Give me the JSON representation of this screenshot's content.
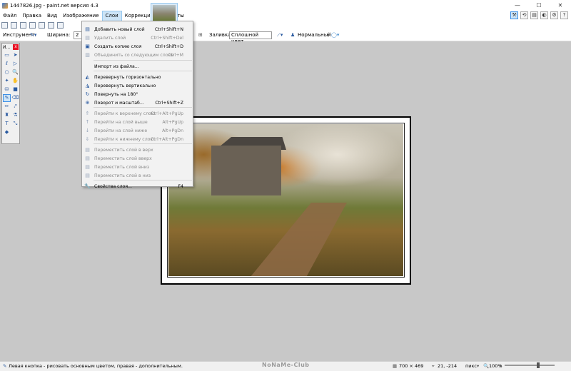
{
  "window": {
    "title": "1447826.jpg - paint.net версия 4.3",
    "minimize": "—",
    "maximize": "☐",
    "close": "✕"
  },
  "menubar": {
    "items": [
      "Файл",
      "Правка",
      "Вид",
      "Изображение",
      "Слои",
      "Коррекция",
      "Эффекты"
    ],
    "active": "Слои"
  },
  "toolbar": {
    "instrument_label": "Инструмент:",
    "width_label": "Ширина:",
    "width_value": "2",
    "fill_label": "Заливка:",
    "fill_value": "Сплошной цвет",
    "blend_value": "Нормальный"
  },
  "toolwindow": {
    "title": "И..."
  },
  "layers_menu": {
    "items": [
      {
        "icon": "add-layer-icon",
        "glyph": "▤",
        "label": "Добавить новый слой",
        "shortcut": "Ctrl+Shift+N",
        "enabled": true
      },
      {
        "icon": "delete-layer-icon",
        "glyph": "▤",
        "label": "Удалить слой",
        "shortcut": "Ctrl+Shift+Del",
        "enabled": false
      },
      {
        "icon": "duplicate-layer-icon",
        "glyph": "▣",
        "label": "Создать копию слоя",
        "shortcut": "Ctrl+Shift+D",
        "enabled": true
      },
      {
        "icon": "merge-down-icon",
        "glyph": "▥",
        "label": "Объединить со следующим слоем",
        "shortcut": "Ctrl+M",
        "enabled": false
      },
      {
        "icon": "",
        "glyph": "",
        "label": "Импорт из файла...",
        "shortcut": "",
        "enabled": true
      },
      {
        "icon": "flip-horizontal-icon",
        "glyph": "◭",
        "label": "Перевернуть горизонтально",
        "shortcut": "",
        "enabled": true
      },
      {
        "icon": "flip-vertical-icon",
        "glyph": "◮",
        "label": "Перевернуть вертикально",
        "shortcut": "",
        "enabled": true
      },
      {
        "icon": "rotate-180-icon",
        "glyph": "↻",
        "label": "Повернуть на 180°",
        "shortcut": "",
        "enabled": true
      },
      {
        "icon": "rotate-zoom-icon",
        "glyph": "⊕",
        "label": "Поворот и масштаб...",
        "shortcut": "Ctrl+Shift+Z",
        "enabled": true
      },
      {
        "icon": "go-top-layer-icon",
        "glyph": "⇑",
        "label": "Перейти к верхнему слою",
        "shortcut": "Ctrl+Alt+PgUp",
        "enabled": false
      },
      {
        "icon": "go-layer-up-icon",
        "glyph": "↑",
        "label": "Перейти на слой выше",
        "shortcut": "Alt+PgUp",
        "enabled": false
      },
      {
        "icon": "go-layer-down-icon",
        "glyph": "↓",
        "label": "Перейти на слой ниже",
        "shortcut": "Alt+PgDn",
        "enabled": false
      },
      {
        "icon": "go-bottom-layer-icon",
        "glyph": "⇓",
        "label": "Перейти к нижнему слою",
        "shortcut": "Ctrl+Alt+PgDn",
        "enabled": false
      },
      {
        "icon": "move-layer-top-icon",
        "glyph": "▤",
        "label": "Переместить слой в верх",
        "shortcut": "",
        "enabled": false
      },
      {
        "icon": "move-layer-up-icon",
        "glyph": "▤",
        "label": "Переместить слой вверх",
        "shortcut": "",
        "enabled": false
      },
      {
        "icon": "move-layer-down-icon",
        "glyph": "▤",
        "label": "Переместить слой вниз",
        "shortcut": "",
        "enabled": false
      },
      {
        "icon": "move-layer-bottom-icon",
        "glyph": "▤",
        "label": "Переместить слой в низ",
        "shortcut": "",
        "enabled": false
      },
      {
        "icon": "layer-properties-icon",
        "glyph": "🔧",
        "label": "Свойства слоя...",
        "shortcut": "F4",
        "enabled": true
      }
    ]
  },
  "statusbar": {
    "hint": "Левая кнопка - рисовать основным цветом, правая - дополнительным.",
    "watermark": "NoNaMe-Club",
    "image_size": "700 × 469",
    "cursor": "21, -214",
    "units": "пикс",
    "zoom": "100%"
  }
}
